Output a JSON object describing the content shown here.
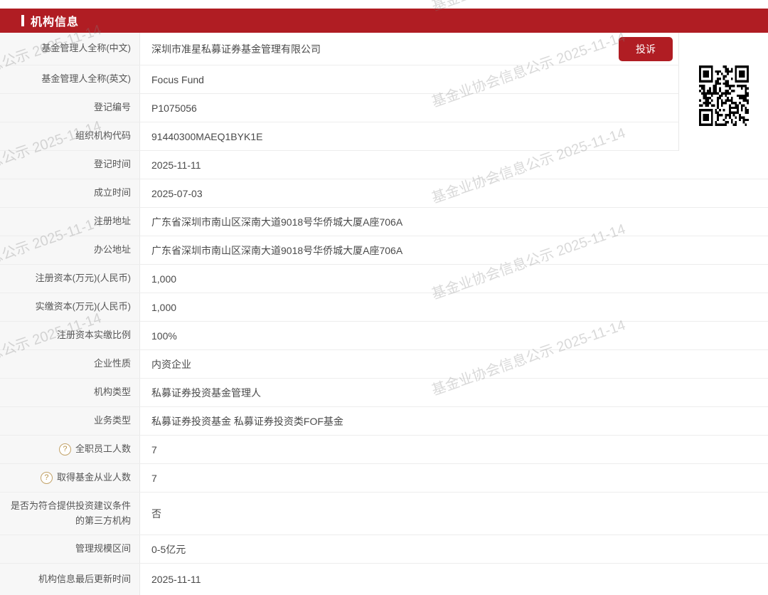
{
  "header": {
    "title": "机构信息",
    "accent_color": "#B01D23"
  },
  "toolbar": {
    "complaint_label": "投诉"
  },
  "watermark": {
    "text": "基金业协会信息公示 2025-11-14"
  },
  "icons": {
    "help_glyph": "?",
    "qr": "qr-code"
  },
  "table": {
    "rows": [
      {
        "label": "基金管理人全称(中文)",
        "value": "深圳市准星私募证券基金管理有限公司",
        "help": false
      },
      {
        "label": "基金管理人全称(英文)",
        "value": "Focus Fund",
        "help": false
      },
      {
        "label": "登记编号",
        "value": "P1075056",
        "help": false
      },
      {
        "label": "组织机构代码",
        "value": "91440300MAEQ1BYK1E",
        "help": false
      },
      {
        "label": "登记时间",
        "value": "2025-11-11",
        "help": false
      },
      {
        "label": "成立时间",
        "value": "2025-07-03",
        "help": false
      },
      {
        "label": "注册地址",
        "value": "广东省深圳市南山区深南大道9018号华侨城大厦A座706A",
        "help": false
      },
      {
        "label": "办公地址",
        "value": "广东省深圳市南山区深南大道9018号华侨城大厦A座706A",
        "help": false
      },
      {
        "label": "注册资本(万元)(人民币)",
        "value": "1,000",
        "help": false
      },
      {
        "label": "实缴资本(万元)(人民币)",
        "value": "1,000",
        "help": false
      },
      {
        "label": "注册资本实缴比例",
        "value": "100%",
        "help": false
      },
      {
        "label": "企业性质",
        "value": "内资企业",
        "help": false
      },
      {
        "label": "机构类型",
        "value": "私募证券投资基金管理人",
        "help": false
      },
      {
        "label": "业务类型",
        "value": "私募证券投资基金 私募证券投资类FOF基金",
        "help": false
      },
      {
        "label": "全职员工人数",
        "value": "7",
        "help": true
      },
      {
        "label": "取得基金从业人数",
        "value": "7",
        "help": true
      },
      {
        "label": "是否为符合提供投资建议条件的第三方机构",
        "value": "否",
        "help": false
      },
      {
        "label": "管理规模区间",
        "value": "0-5亿元",
        "help": false
      },
      {
        "label": "机构信息最后更新时间",
        "value": "2025-11-11",
        "help": false
      }
    ]
  }
}
